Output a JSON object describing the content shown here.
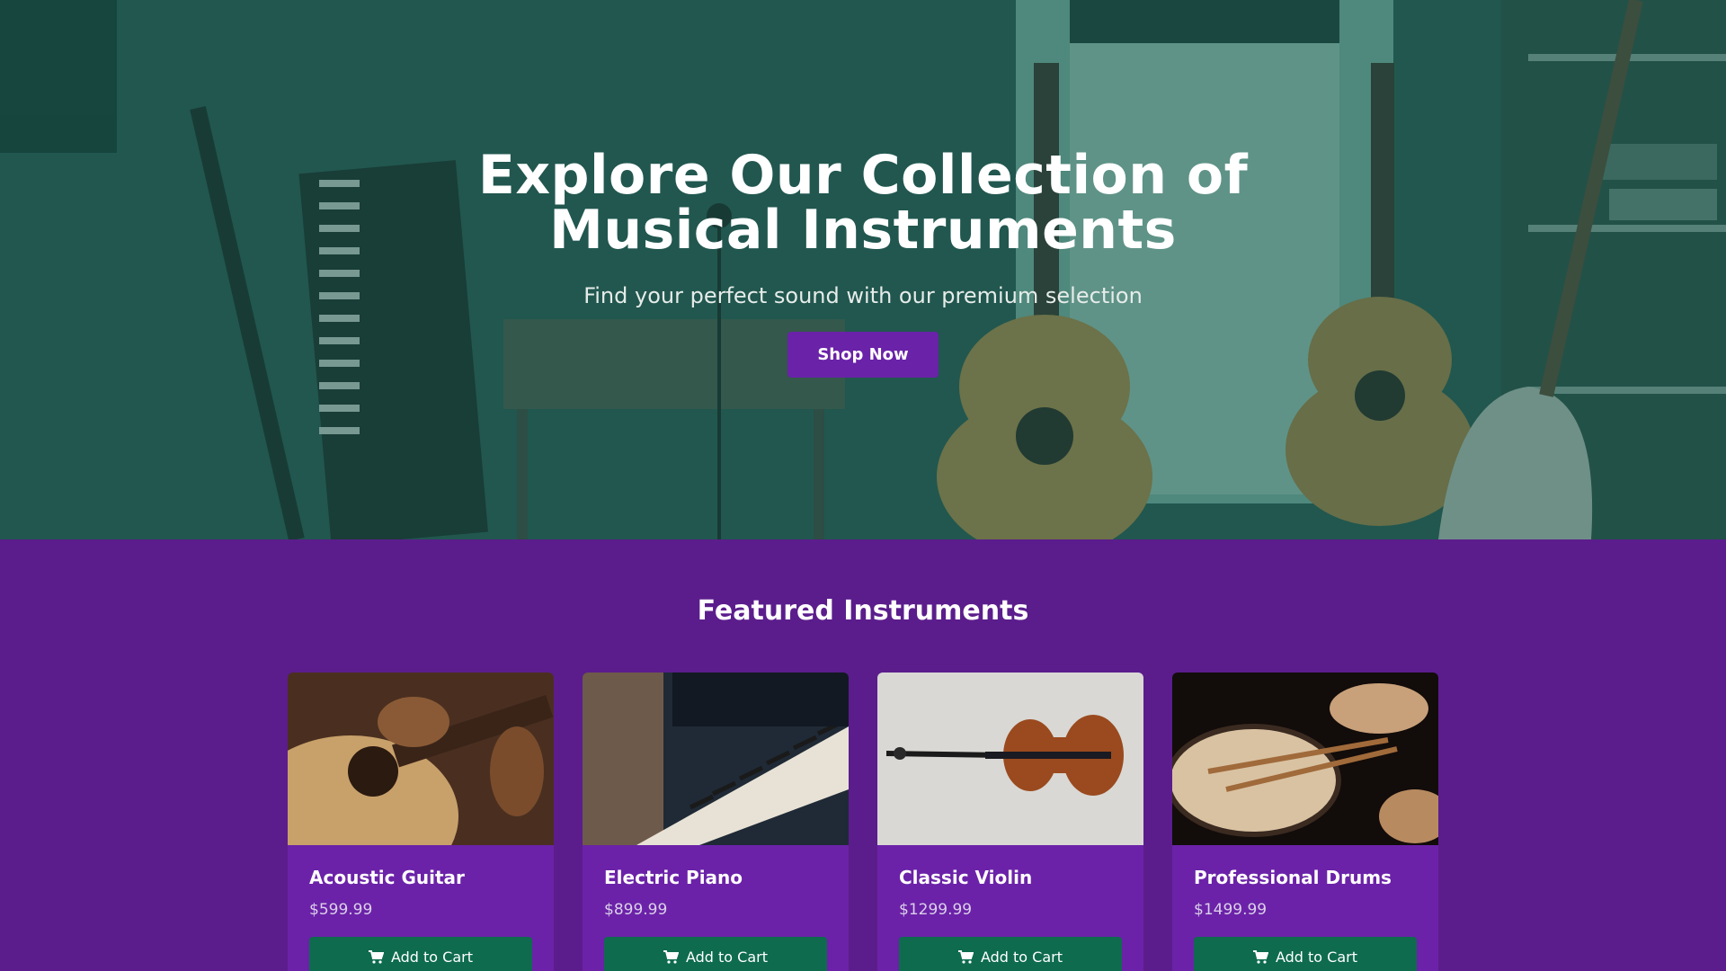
{
  "hero": {
    "title": "Explore Our Collection of Musical Instruments",
    "subtitle": "Find your perfect sound with our premium selection",
    "cta_label": "Shop Now"
  },
  "featured": {
    "heading": "Featured Instruments",
    "products": [
      {
        "name": "Acoustic Guitar",
        "price": "$599.99",
        "button_label": "Add to Cart",
        "image_icon": "guitar-photo"
      },
      {
        "name": "Electric Piano",
        "price": "$899.99",
        "button_label": "Add to Cart",
        "image_icon": "piano-photo"
      },
      {
        "name": "Classic Violin",
        "price": "$1299.99",
        "button_label": "Add to Cart",
        "image_icon": "violin-photo"
      },
      {
        "name": "Professional Drums",
        "price": "$1499.99",
        "button_label": "Add to Cart",
        "image_icon": "drums-photo"
      }
    ]
  },
  "colors": {
    "hero_overlay": "#16544a",
    "section_bg": "#5b1d8c",
    "card_bg": "#6b22a8",
    "primary_button": "#6a22a8",
    "cart_button": "#0e6b4e"
  }
}
